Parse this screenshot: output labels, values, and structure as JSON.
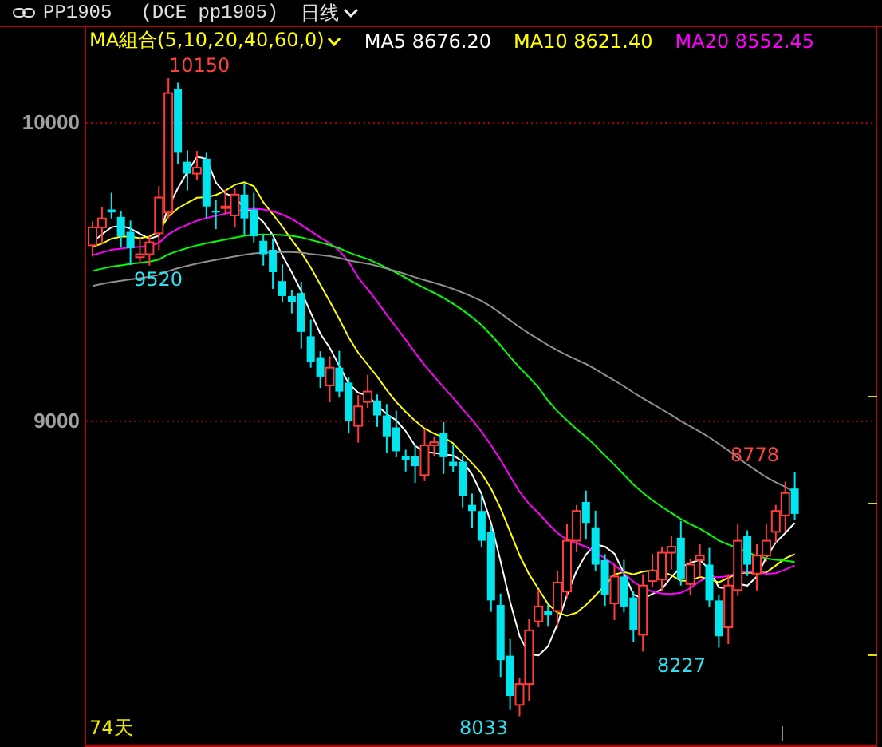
{
  "header": {
    "symbol": "PP1905",
    "exchange_code": "(DCE pp1905)",
    "period": "日线"
  },
  "legend": {
    "ma_group": "MA組合(5,10,20,40,60,0)",
    "ma_values": [
      {
        "label": "MA5 8676.20",
        "color": "#ffffff"
      },
      {
        "label": "MA10 8621.40",
        "color": "#ffff00"
      },
      {
        "label": "MA20 8552.45",
        "color": "#ff00ff"
      }
    ]
  },
  "axis": {
    "ticks": [
      "10000",
      "9000"
    ]
  },
  "annotations": [
    {
      "text": "10150",
      "kind": "high"
    },
    {
      "text": "9520",
      "kind": "low"
    },
    {
      "text": "8033",
      "kind": "low"
    },
    {
      "text": "8227",
      "kind": "low"
    },
    {
      "text": "8778",
      "kind": "high"
    }
  ],
  "footer": {
    "day_count": "74天"
  }
}
